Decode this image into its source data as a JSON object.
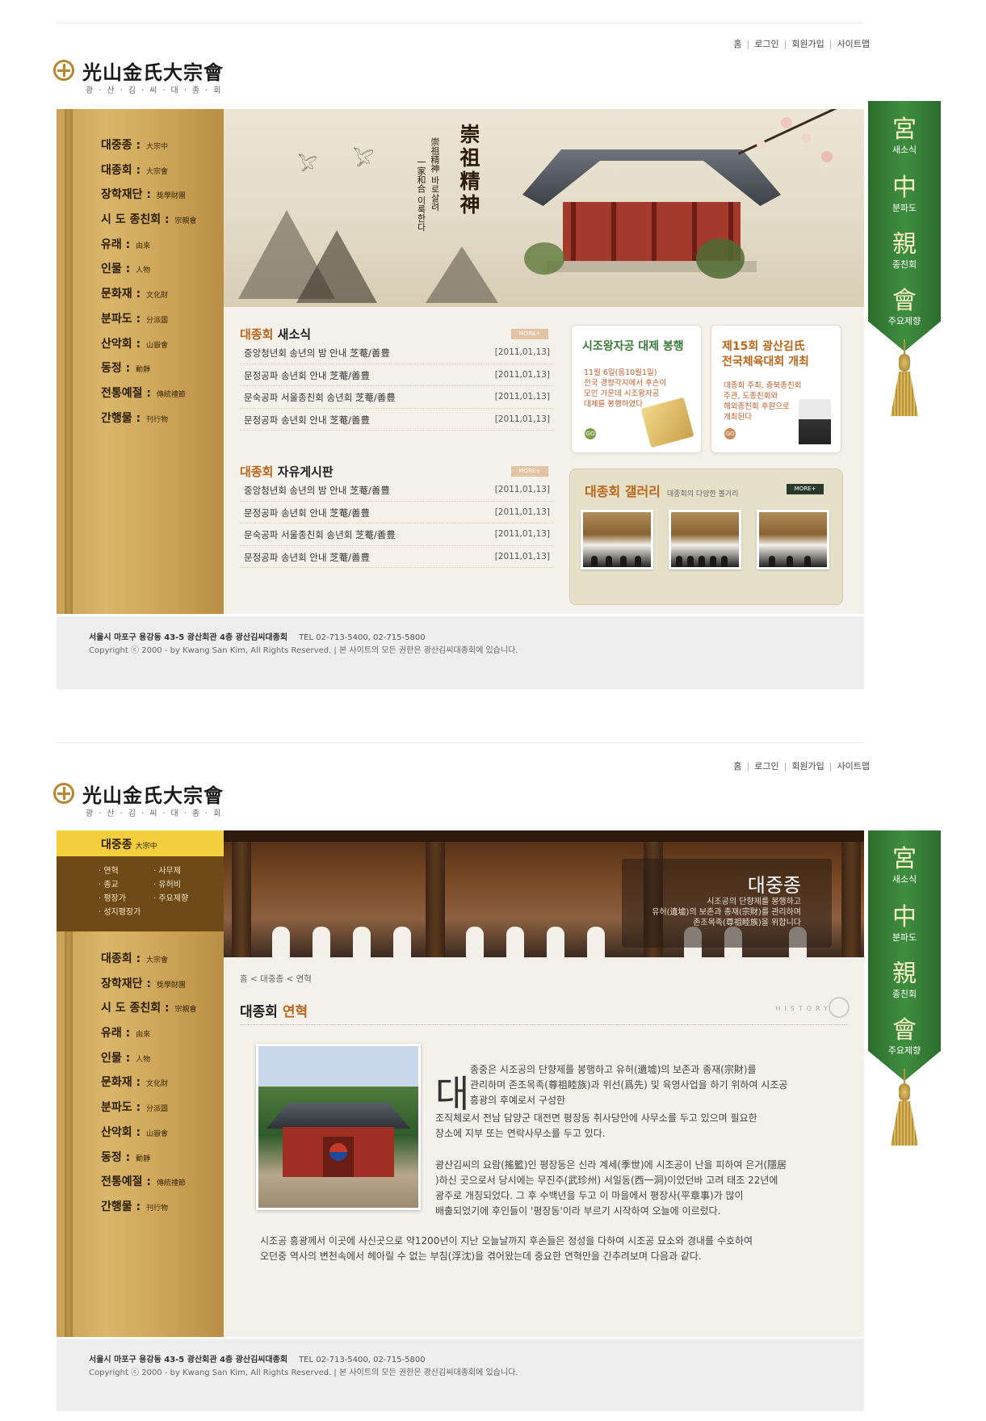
{
  "site": {
    "title": "光山金氏大宗會",
    "subtitle": "광·산·김·씨·대·종·회",
    "top_links": [
      "홈",
      "로그인",
      "회원가입",
      "사이트맵"
    ]
  },
  "menu": [
    {
      "label": "대중종",
      "hanja": "大宗中"
    },
    {
      "label": "대종회",
      "hanja": "大宗會"
    },
    {
      "label": "장학재단",
      "hanja": "獎學財團"
    },
    {
      "label": "시 도 종친회",
      "hanja": "宗親會"
    },
    {
      "label": "유래",
      "hanja": "由來"
    },
    {
      "label": "인물",
      "hanja": "人物"
    },
    {
      "label": "문화재",
      "hanja": "文化財"
    },
    {
      "label": "분파도",
      "hanja": "分派圖"
    },
    {
      "label": "산악회",
      "hanja": "山嶽會"
    },
    {
      "label": "동정",
      "hanja": "動靜"
    },
    {
      "label": "전통예절",
      "hanja": "傳統禮節"
    },
    {
      "label": "간행물",
      "hanja": "刊行物"
    }
  ],
  "submenu": [
    "연혁",
    "사무제",
    "종교",
    "유허비",
    "평장가",
    "주요제향",
    "성지평장가"
  ],
  "hero": {
    "calligraphy": "崇祖精神",
    "slogan_a": "崇祖精神 바로살려",
    "slogan_b": "一家和合 이룩한다"
  },
  "news": {
    "title_hl": "대종회",
    "title_rest": "새소식",
    "more": "MORE+",
    "items": [
      {
        "text": "중앙청년회 송년의 밤 안내  芝菴/善豊",
        "date": "[2011,01,13]"
      },
      {
        "text": "문정공파 송년회 안내  芝菴/善豊",
        "date": "[2011,01,13]"
      },
      {
        "text": "문숙공파 서울종친회 송년회  芝菴/善豊",
        "date": "[2011,01,13]"
      },
      {
        "text": "문정공파 송년회 안내  芝菴/善豊",
        "date": "[2011,01,13]"
      }
    ]
  },
  "board": {
    "title_hl": "대종회",
    "title_rest": "자유게시판",
    "more": "MORE+",
    "items": [
      {
        "text": "중앙청년회 송년의 밤 안내  芝菴/善豊",
        "date": "[2011,01,13]"
      },
      {
        "text": "문정공파 송년회 안내  芝菴/善豊",
        "date": "[2011,01,13]"
      },
      {
        "text": "문숙공파 서울종친회 송년회  芝菴/善豊",
        "date": "[2011,01,13]"
      },
      {
        "text": "문정공파 송년회 안내  芝菴/善豊",
        "date": "[2011,01,13]"
      }
    ]
  },
  "cards": [
    {
      "title": "시조왕자공 대제 봉행",
      "body": "11월 6일(음10월1일)\n전국 경향각지에서 후손이\n모인 가운데 시조왕자공\n대제를 봉행하였다",
      "go": "GO",
      "title_color": "#3a7a3a"
    },
    {
      "title": "제15회 광산김氏\n전국체육대회 개최",
      "body": "대종회 주최, 충북종친회\n주관, 도종친회와\n해외종친회 후원으로\n개최된다",
      "go": "GO",
      "title_color": "#b9651a"
    }
  ],
  "gallery": {
    "title": "대종회 갤러리",
    "desc": "대종회의 다양한 볼거리",
    "more": "MORE+"
  },
  "footer": {
    "address": "서울시 마포구 용강동 43-5 광산회관 4층 광산김씨대종회",
    "tel": "TEL 02-713-5400, 02-715-5800",
    "copyright": "Copyright ⓒ 2000 - by Kwang San Kim, All Rights Reserved.  |  본 사이트의 모든 권한은 광산김씨대종회에 있습니다."
  },
  "banner": [
    {
      "glyph": "宮",
      "label": "새소식"
    },
    {
      "glyph": "中",
      "label": "분파도"
    },
    {
      "glyph": "親",
      "label": "종친회"
    },
    {
      "glyph": "會",
      "label": "주요제향"
    }
  ],
  "sub_page": {
    "active_menu": {
      "label": "대중종",
      "hanja": "大宗中"
    },
    "banner_title": "대중종",
    "banner_desc": "시조공의 단향제를 봉행하고\n유허(遺墟)의 보존과 종재(宗財)를 관리하며\n존조목족(尊祖睦族)을 위합니다",
    "breadcrumb": [
      "홈",
      "대중종",
      "연혁"
    ],
    "page_title_a": "대종회",
    "page_title_b": "연혁",
    "history_word": "HISTORY",
    "dropcap": "대",
    "para1": "종중은 시조공의 단향제를 봉행하고 유허(遺墟)의 보존과 종재(宗財)를\n관리하며 존조목족(尊祖睦族)과 위선(爲先) 및 육영사업을 하기 위하여 시조공\n흥광의 후예로서 구성한",
    "para2": "조직체로서 전남 담양군 대전면 평장동 취사당안에 사무소를 두고 있으며 필요한\n장소에 지부 또는 연락사무소를 두고 있다.",
    "para3": "광산김씨의 요람(搖籃)인 평장동은 신라 계세(季世)에 시조공이 난을 피하여 은거(隱居\n)하신 곳으로서 당시에는 무진주(武珍州) 서일동(西一洞)이었던바 고려 태조 22년에\n광주로 개칭되었다. 그 후 수백년을 두고 이 마을에서 평장사(平章事)가 많이\n배출되었기에 후인들이 '평장동'이라 부르기 시작하여 오늘에 이르렀다.",
    "para4": "시조공 흥광께서 이곳에 사신곳으로 약1200년이 지난 오늘날까지 후손들은 정성을 다하여 시조공 묘소와 경내를 수호하여\n오던중 역사의 변천속에서 헤아릴 수 없는 부침(浮沈)을 겪어왔는데 중요한 연혁만을 간추려보며 다음과 같다."
  }
}
